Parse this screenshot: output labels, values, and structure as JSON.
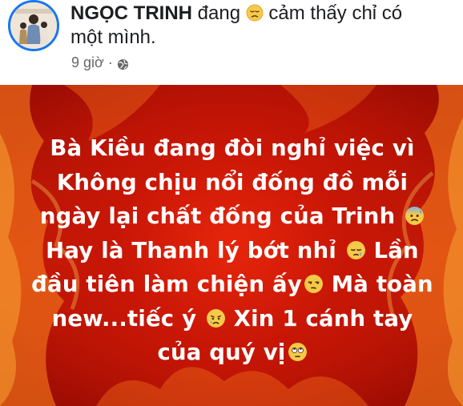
{
  "post": {
    "author_name": "NGỌC TRINH",
    "feeling_prefix": "đang",
    "feeling_icon": "sad-face-emoji",
    "feeling_line1": "cảm thấy chỉ có",
    "feeling_line2": "một mình.",
    "time": "9 giờ",
    "separator": "·",
    "privacy_icon": "globe-icon",
    "lines": [
      {
        "text": "Bà Kiều đang đòi nghỉ việc vì",
        "emoji": ""
      },
      {
        "text": "Không chịu nổi đống đồ mỗi",
        "emoji": ""
      },
      {
        "text": "ngày lại chất đống của Trinh",
        "emoji": "anxious-sweat-face"
      },
      {
        "text": "Hay là Thanh lý bớt nhỉ",
        "emoji": "sleepy-face",
        "after": " Lần"
      },
      {
        "text": "đầu tiên làm chiện ấy",
        "emoji": "unamused-face",
        "after": " Mà toàn"
      },
      {
        "text": "new...tiếc ý",
        "emoji": "crying-face",
        "after": " Xin 1 cánh tay"
      },
      {
        "text": "của quý vị",
        "emoji": "eye-roll-face"
      }
    ]
  },
  "colors": {
    "accent": "#1877f2",
    "text": "#1c1e21",
    "meta": "#65676b",
    "fire": "#c81606"
  }
}
